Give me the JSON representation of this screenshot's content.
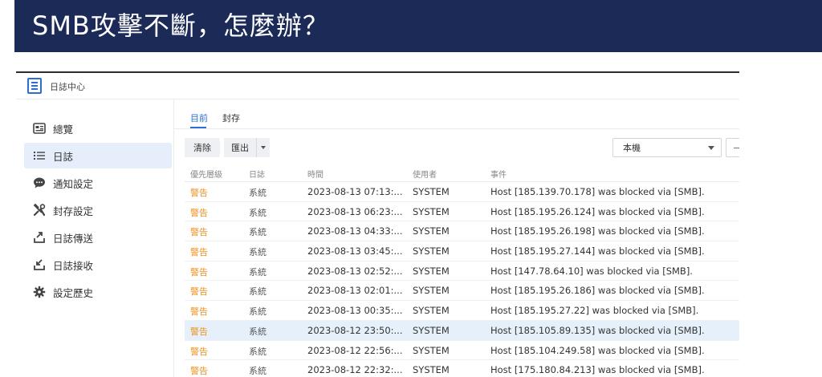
{
  "banner": {
    "title": "SMB攻擊不斷，怎麼辦？"
  },
  "app": {
    "title": "日誌中心"
  },
  "sidebar": {
    "items": [
      {
        "label": "總覽",
        "icon": "overview-icon",
        "active": false
      },
      {
        "label": "日誌",
        "icon": "list-icon",
        "active": true
      },
      {
        "label": "通知設定",
        "icon": "chat-bubble-icon",
        "active": false
      },
      {
        "label": "封存設定",
        "icon": "tools-icon",
        "active": false
      },
      {
        "label": "日誌傳送",
        "icon": "upload-icon",
        "active": false
      },
      {
        "label": "日誌接收",
        "icon": "download-icon",
        "active": false
      },
      {
        "label": "設定歷史",
        "icon": "gear-icon",
        "active": false
      }
    ]
  },
  "tabs": [
    {
      "label": "目前",
      "active": true
    },
    {
      "label": "封存",
      "active": false
    }
  ],
  "toolbar": {
    "clear_label": "清除",
    "export_label": "匯出",
    "source_select": "本機",
    "second_select": "—"
  },
  "table": {
    "columns": [
      "優先層級",
      "日誌",
      "時間",
      "使用者",
      "事件"
    ],
    "rows": [
      {
        "level": "警告",
        "log": "系統",
        "time": "2023-08-13 07:13:...",
        "user": "SYSTEM",
        "event": "Host [185.139.70.178] was blocked via [SMB]."
      },
      {
        "level": "警告",
        "log": "系統",
        "time": "2023-08-13 06:23:...",
        "user": "SYSTEM",
        "event": "Host [185.195.26.124] was blocked via [SMB]."
      },
      {
        "level": "警告",
        "log": "系統",
        "time": "2023-08-13 04:33:...",
        "user": "SYSTEM",
        "event": "Host [185.195.26.198] was blocked via [SMB]."
      },
      {
        "level": "警告",
        "log": "系統",
        "time": "2023-08-13 03:45:...",
        "user": "SYSTEM",
        "event": "Host [185.195.27.144] was blocked via [SMB]."
      },
      {
        "level": "警告",
        "log": "系統",
        "time": "2023-08-13 02:52:...",
        "user": "SYSTEM",
        "event": "Host [147.78.64.10] was blocked via [SMB]."
      },
      {
        "level": "警告",
        "log": "系統",
        "time": "2023-08-13 02:01:...",
        "user": "SYSTEM",
        "event": "Host [185.195.26.186] was blocked via [SMB]."
      },
      {
        "level": "警告",
        "log": "系統",
        "time": "2023-08-13 00:35:...",
        "user": "SYSTEM",
        "event": "Host [185.195.27.22] was blocked via [SMB]."
      },
      {
        "level": "警告",
        "log": "系統",
        "time": "2023-08-12 23:50:...",
        "user": "SYSTEM",
        "event": "Host [185.105.89.135] was blocked via [SMB].",
        "selected": true
      },
      {
        "level": "警告",
        "log": "系統",
        "time": "2023-08-12 22:56:...",
        "user": "SYSTEM",
        "event": "Host [185.104.249.58] was blocked via [SMB]."
      },
      {
        "level": "警告",
        "log": "系統",
        "time": "2023-08-12 22:32:...",
        "user": "SYSTEM",
        "event": "Host [175.180.84.213] was blocked via [SMB]."
      }
    ]
  },
  "colors": {
    "banner_bg": "#1b2a57",
    "accent": "#2b6fd6",
    "warning": "#f0901c",
    "selected_row": "#e5f0fb"
  }
}
